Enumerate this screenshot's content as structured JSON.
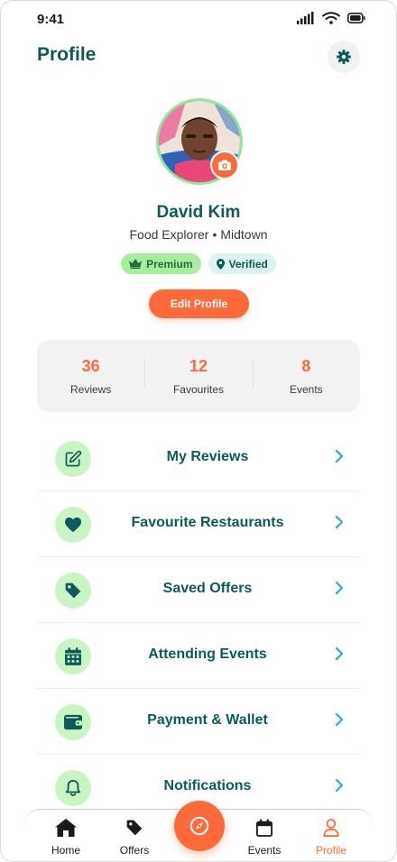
{
  "status_bar": {
    "time": "9:41"
  },
  "header": {
    "title": "Profile"
  },
  "profile": {
    "name": "David Kim",
    "role": "Food Explorer",
    "location": "Midtown",
    "separator": "•",
    "badges": [
      {
        "label": "Premium",
        "icon": "crown-icon"
      },
      {
        "label": "Verified",
        "icon": "location-pin-icon"
      }
    ],
    "edit_label": "Edit Profile"
  },
  "stats": [
    {
      "value": "36",
      "label": "Reviews"
    },
    {
      "value": "12",
      "label": "Favourites"
    },
    {
      "value": "8",
      "label": "Events"
    }
  ],
  "menu": [
    {
      "label": "My Reviews",
      "icon": "edit-icon"
    },
    {
      "label": "Favourite Restaurants",
      "icon": "heart-icon"
    },
    {
      "label": "Saved Offers",
      "icon": "tag-icon"
    },
    {
      "label": "Attending Events",
      "icon": "calendar-icon"
    },
    {
      "label": "Payment & Wallet",
      "icon": "wallet-icon"
    },
    {
      "label": "Notifications",
      "icon": "bell-icon"
    }
  ],
  "tabs": [
    {
      "label": "Home",
      "icon": "home-icon"
    },
    {
      "label": "Offers",
      "icon": "tag-icon"
    },
    {
      "label": "",
      "icon": "compass-icon"
    },
    {
      "label": "Events",
      "icon": "calendar-icon"
    },
    {
      "label": "Profile",
      "icon": "user-icon",
      "active": true
    }
  ],
  "colors": {
    "accent": "#ff6a3a",
    "primary_text": "#0e5a5a",
    "icon_bg": "#c9f5c4",
    "premium_bg": "#a6ee9c",
    "verified_bg": "#dcf3f4",
    "chevron": "#3fb3c6"
  }
}
